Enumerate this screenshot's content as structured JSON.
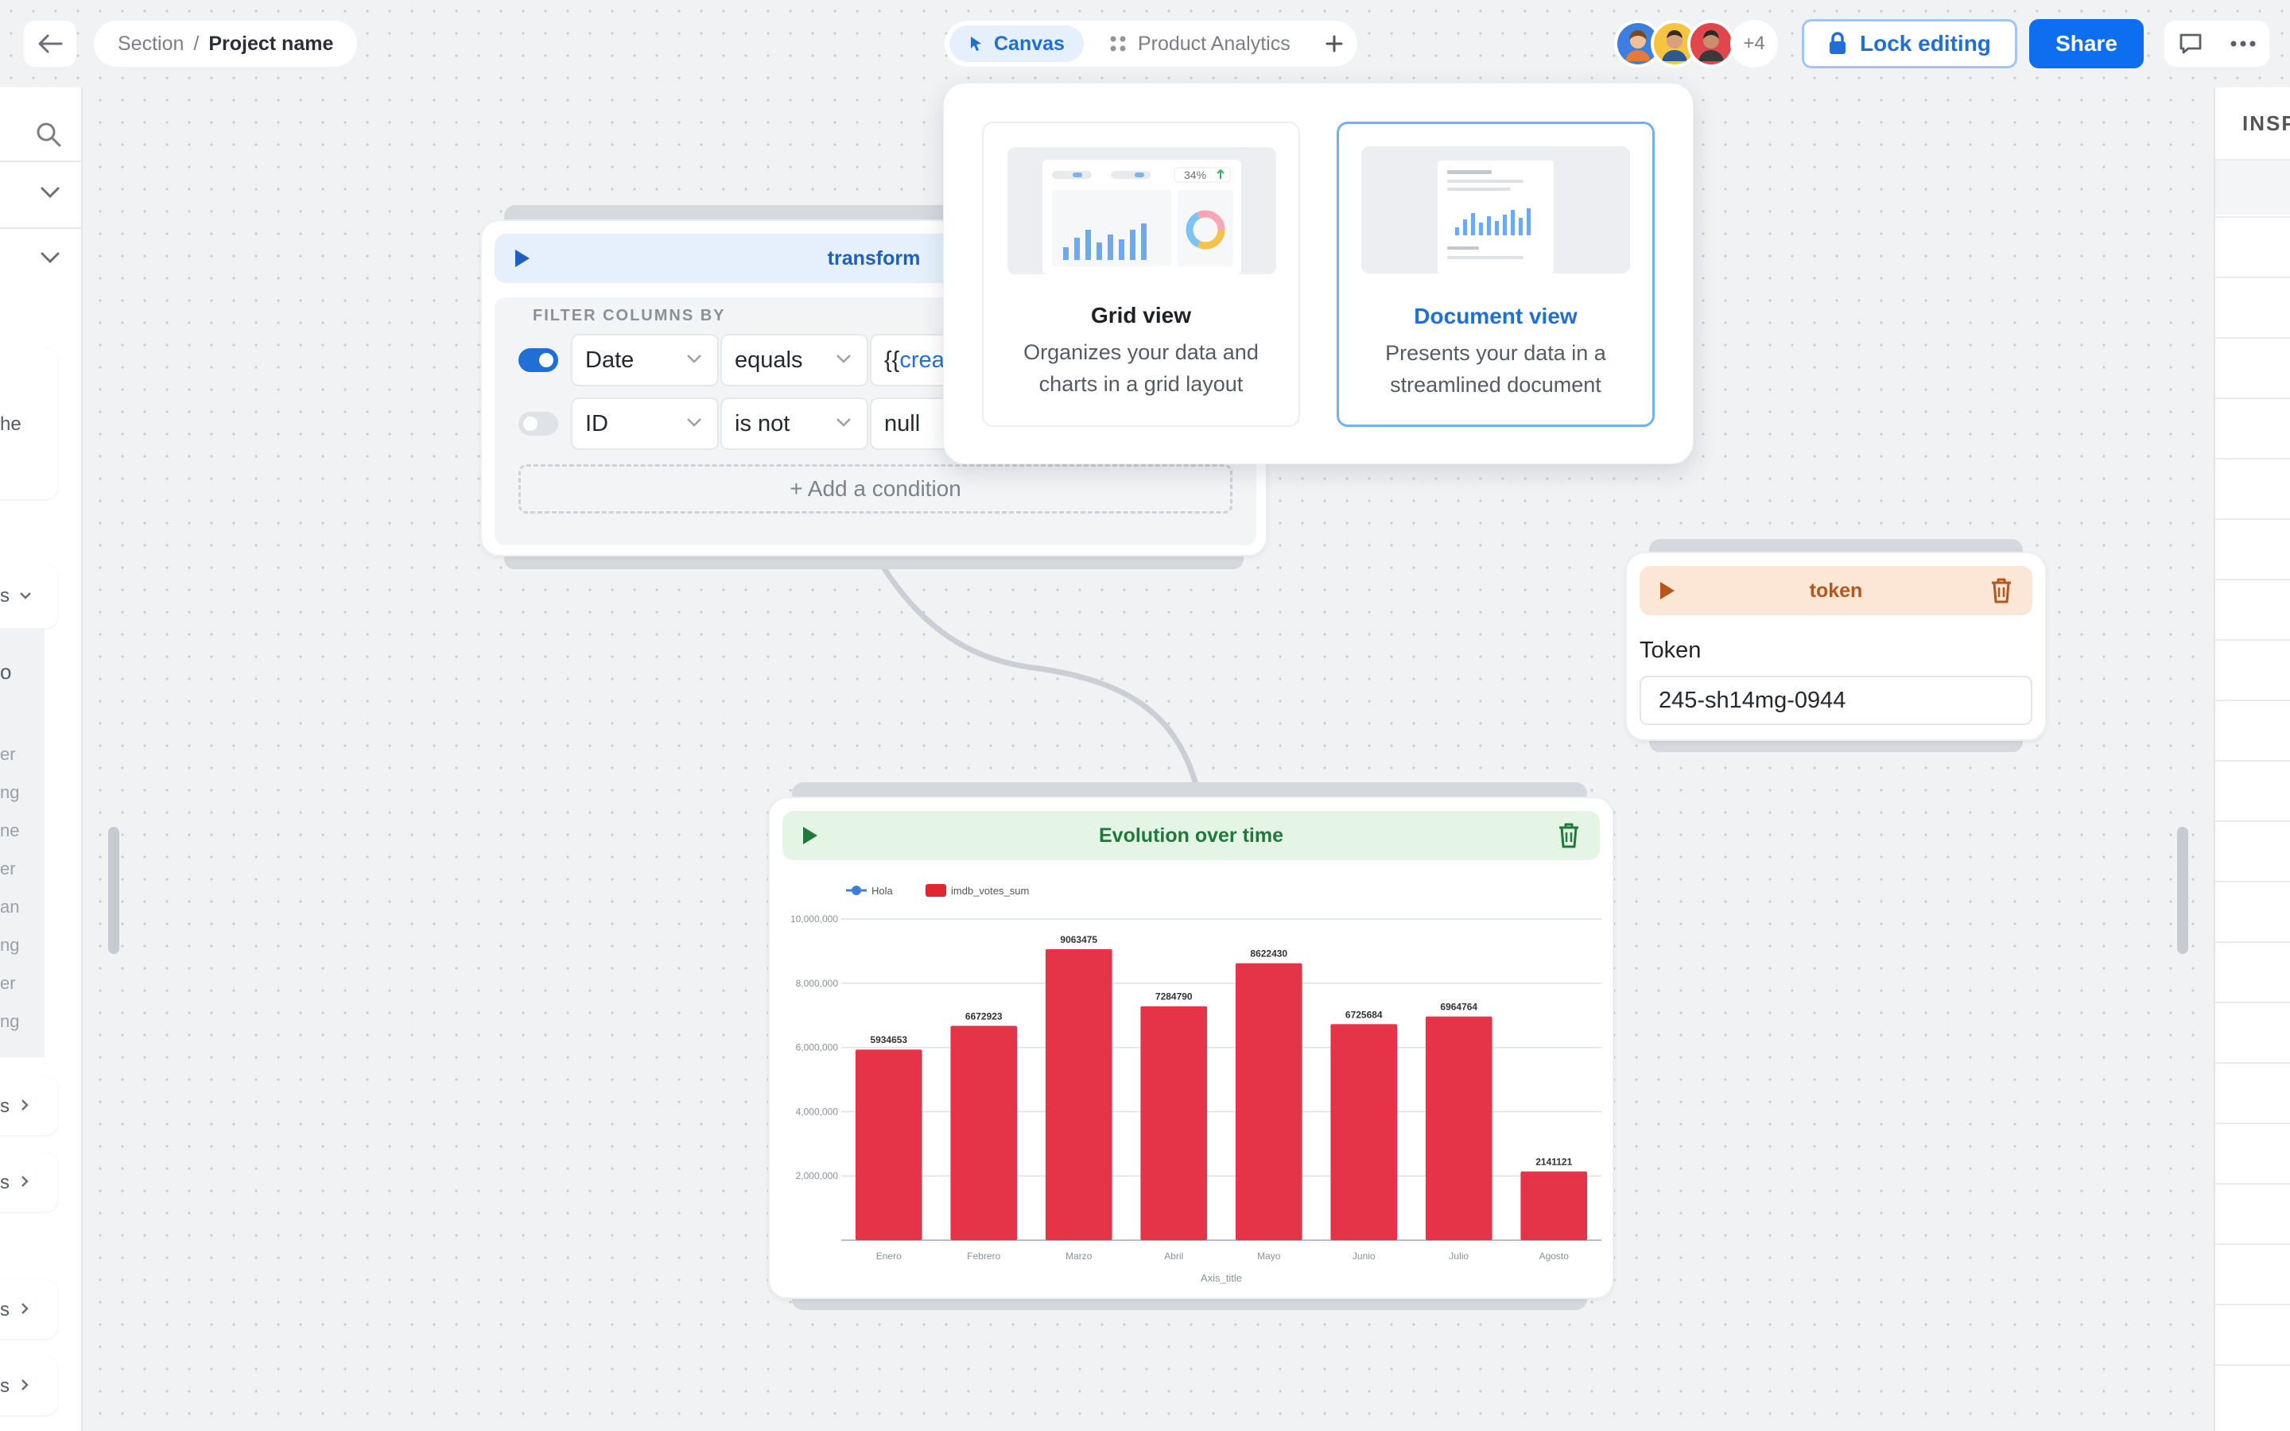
{
  "topbar": {
    "breadcrumb_section": "Section",
    "breadcrumb_sep": "/",
    "breadcrumb_project": "Project name",
    "tabs": [
      {
        "label": "Canvas",
        "active": true
      },
      {
        "label": "Product Analytics",
        "active": false
      }
    ],
    "avatars_more": "+4",
    "lock_label": "Lock editing",
    "share_label": "Share"
  },
  "left_sidebar": {
    "snippets": [
      "he",
      "s",
      "o",
      "er",
      "ng",
      "ne",
      "er",
      "an",
      "ng",
      "er",
      "ng",
      "s",
      "s",
      "s",
      "s"
    ]
  },
  "right_sidebar": {
    "header": "INSP"
  },
  "transform_node": {
    "title": "transform",
    "filter_label": "FILTER COLUMNS BY",
    "conditions": [
      {
        "enabled": true,
        "column": "Date",
        "operator": "equals",
        "value_prefix": "{{",
        "value_var": "crea"
      },
      {
        "enabled": false,
        "column": "ID",
        "operator": "is not",
        "value_prefix": "null",
        "value_var": ""
      }
    ],
    "add_condition": "+ Add a condition",
    "accent": "#1f5fbf"
  },
  "view_popover": {
    "options": [
      {
        "title": "Grid view",
        "description": "Organizes your data and charts in a grid layout",
        "thumb_badge": "34%",
        "selected": false
      },
      {
        "title": "Document view",
        "description": "Presents your data in a streamlined document",
        "selected": true
      }
    ]
  },
  "token_node": {
    "title": "token",
    "field_label": "Token",
    "value": "245-sh14mg-0944",
    "accent": "#b8551a"
  },
  "chart_node": {
    "title": "Evolution over time",
    "accent": "#1f7a3a"
  },
  "chart_data": {
    "type": "bar",
    "legend": [
      {
        "name": "Hola",
        "color": "#3f7fd0",
        "marker": "line"
      },
      {
        "name": "imdb_votes_sum",
        "color": "#e0262e",
        "marker": "box"
      }
    ],
    "categories": [
      "Enero",
      "Febrero",
      "Marzo",
      "Abril",
      "Mayo",
      "Junio",
      "Julio",
      "Agosto"
    ],
    "values": [
      5934653,
      6672923,
      9063475,
      7284790,
      8622430,
      6725684,
      6964764,
      2141121
    ],
    "data_labels": [
      "5934653",
      "6672923",
      "9063475",
      "7284790",
      "8622430",
      "6725684",
      "6964764",
      "2141121"
    ],
    "ylim": [
      0,
      10000000
    ],
    "yticks": [
      "10,000,000",
      "8,000,000",
      "6,000,000",
      "4,000,000",
      "2,000,000"
    ],
    "xlabel": "Axis_title",
    "ylabel": "",
    "bar_color": "#e53447",
    "grid": true,
    "legend_position": "top-left"
  }
}
